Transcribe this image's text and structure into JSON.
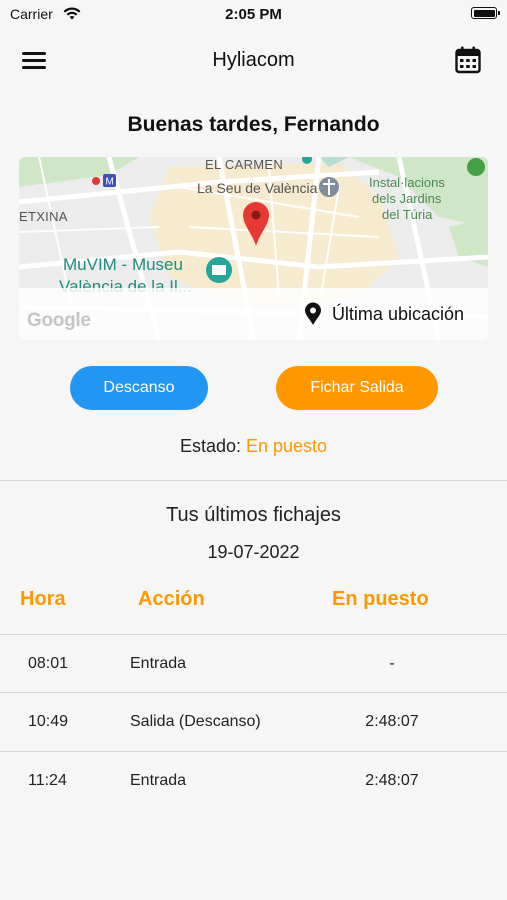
{
  "status_bar": {
    "carrier": "Carrier",
    "time": "2:05 PM"
  },
  "header": {
    "title": "Hyliacom"
  },
  "greeting": "Buenas tardes, Fernando",
  "map": {
    "labels": {
      "el_carmen": "EL CARMEN",
      "seu": "La Seu de València",
      "jardins_1": "Instal·lacions",
      "jardins_2": "dels Jardins",
      "jardins_3": "del Túria",
      "etxina": "ETXINA",
      "muvim_1": "MuVIM - Museu",
      "muvim_2": "València de la Il..."
    },
    "google": "Google",
    "last_location": "Última ubicación"
  },
  "actions": {
    "break_label": "Descanso",
    "clock_out_label": "Fichar Salida"
  },
  "status": {
    "label": "Estado:",
    "value": "En puesto"
  },
  "history": {
    "title": "Tus últimos fichajes",
    "date": "19-07-2022",
    "columns": {
      "hora": "Hora",
      "accion": "Acción",
      "en_puesto": "En puesto"
    },
    "rows": [
      {
        "hora": "08:01",
        "accion": "Entrada",
        "en_puesto": "-"
      },
      {
        "hora": "10:49",
        "accion": "Salida (Descanso)",
        "en_puesto": "2:48:07"
      },
      {
        "hora": "11:24",
        "accion": "Entrada",
        "en_puesto": "2:48:07"
      }
    ]
  },
  "colors": {
    "accent": "#ff9800",
    "primary": "#2196f3",
    "background": "#f6f6f6"
  }
}
